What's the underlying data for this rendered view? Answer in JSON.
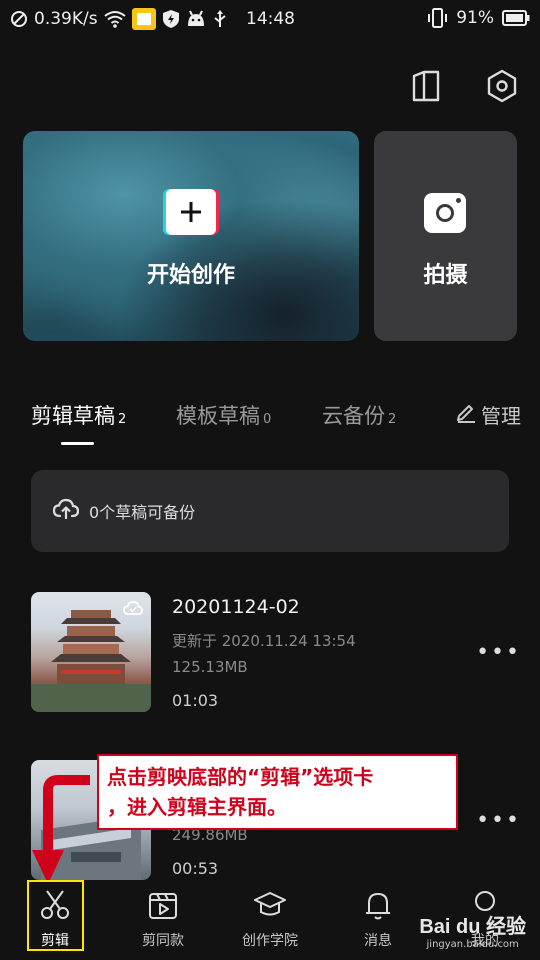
{
  "status_bar": {
    "network_speed": "0.39K/s",
    "time": "14:48",
    "battery": "91%"
  },
  "top_icons": [
    "book-icon",
    "settings-hex-icon"
  ],
  "create_card": {
    "label": "开始创作"
  },
  "shoot_card": {
    "label": "拍摄"
  },
  "tabs": [
    {
      "label": "剪辑草稿",
      "count": "2"
    },
    {
      "label": "模板草稿",
      "count": "0"
    },
    {
      "label": "云备份",
      "count": "2"
    }
  ],
  "manage_label": "管理",
  "backup": {
    "text": "0个草稿可备份"
  },
  "drafts": [
    {
      "name": "20201124-02",
      "updated": "更新于 2020.11.24 13:54",
      "size": "125.13MB",
      "duration": "01:03"
    },
    {
      "size": "249.86MB",
      "duration": "00:53"
    }
  ],
  "annotation": {
    "line1": "点击剪映底部的“剪辑”选项卡",
    "line2": "，进入剪辑主界面。"
  },
  "bottom_nav": [
    {
      "label": "剪辑",
      "icon": "scissors-icon",
      "active": true
    },
    {
      "label": "剪同款",
      "icon": "template-play-icon"
    },
    {
      "label": "创作学院",
      "icon": "graduation-cap-icon"
    },
    {
      "label": "消息",
      "icon": "bell-icon"
    },
    {
      "label": "我的",
      "icon": "profile-icon"
    }
  ],
  "watermark": {
    "main": "Bai du 经验",
    "sub": "jingyan.baidu.com"
  },
  "colors": {
    "background": "#121212",
    "annotation_red": "#d0021b",
    "highlight_yellow": "#ffe600"
  }
}
